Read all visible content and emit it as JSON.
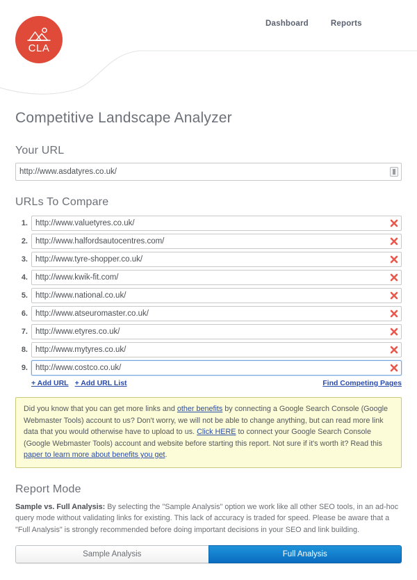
{
  "header": {
    "logo_text": "CLA",
    "logo_icon": "mountain-peaks-icon",
    "nav": [
      {
        "label": "Dashboard"
      },
      {
        "label": "Reports"
      }
    ]
  },
  "page": {
    "title": "Competitive Landscape Analyzer"
  },
  "your_url": {
    "label": "Your URL",
    "value": "http://www.asdatyres.co.uk/",
    "placeholder": "http://",
    "autofill_icon": "autofill-icon"
  },
  "compare": {
    "label": "URLs To Compare",
    "rows": [
      {
        "num": "1.",
        "value": "http://www.valuetyres.co.uk/",
        "focused": false
      },
      {
        "num": "2.",
        "value": "http://www.halfordsautocentres.com/",
        "focused": false
      },
      {
        "num": "3.",
        "value": "http://www.tyre-shopper.co.uk/",
        "focused": false
      },
      {
        "num": "4.",
        "value": "http://www.kwik-fit.com/",
        "focused": false
      },
      {
        "num": "5.",
        "value": "http://www.national.co.uk/",
        "focused": false
      },
      {
        "num": "6.",
        "value": "http://www.atseuromaster.co.uk/",
        "focused": false
      },
      {
        "num": "7.",
        "value": "http://www.etyres.co.uk/",
        "focused": false
      },
      {
        "num": "8.",
        "value": "http://www.mytyres.co.uk/",
        "focused": false
      },
      {
        "num": "9.",
        "value": "http://www.costco.co.uk/",
        "focused": true
      }
    ],
    "remove_icon": "remove-x-icon",
    "add_url_label": "+ Add URL",
    "add_url_list_label": "+ Add URL List",
    "find_competing_label": "Find Competing Pages"
  },
  "notice": {
    "part1": "Did you know that you can get more links and ",
    "link1": "other benefits",
    "part2": " by connecting a Google Search Console (Google Webmaster Tools) account to us? Don't worry, we will not be able to change anything, but can read more link data that you would otherwise have to upload to us. ",
    "link2": "Click HERE",
    "part3": " to connect your Google Search Console (Google Webmaster Tools) account and website before starting this report. Not sure if it's worth it? Read this ",
    "link3": "paper to learn more about benefits you get",
    "part4": "."
  },
  "report_mode": {
    "title": "Report Mode",
    "desc_bold": "Sample vs. Full Analysis:",
    "desc_rest": " By selecting the \"Sample Analysis\" option we work like all other SEO tools, in an ad-hoc query mode without validating links for existing. This lack of accuracy is traded for speed. Please be aware that a \"Full Analysis\" is strongly recommended before doing important decisions in your SEO and link building.",
    "sample_label": "Sample Analysis",
    "full_label": "Full Analysis",
    "selected": "Full Analysis"
  },
  "colors": {
    "brand_red": "#e04a38",
    "link_blue": "#2b4ca8",
    "active_blue": "#0a6cc0",
    "notice_bg": "#fcfcd9",
    "notice_border": "#c9c97e",
    "remove_red": "#e8584c"
  }
}
